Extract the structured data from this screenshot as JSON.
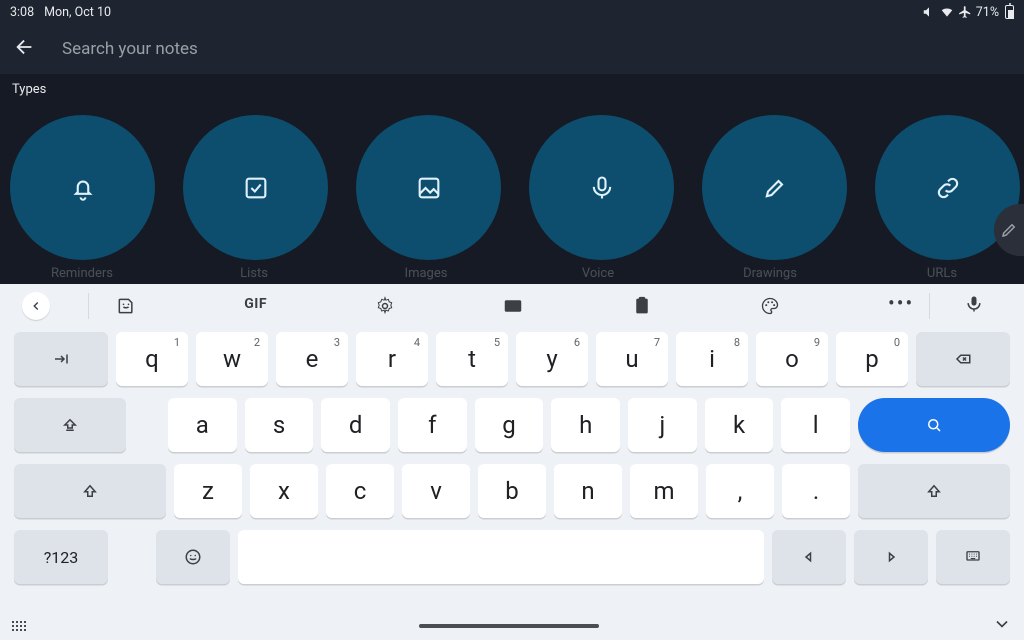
{
  "status": {
    "time": "3:08",
    "date": "Mon, Oct 10",
    "battery_pct": "71%"
  },
  "search": {
    "placeholder": "Search your notes",
    "value": ""
  },
  "types": {
    "label": "Types",
    "items": [
      {
        "name": "Reminders",
        "icon": "bell"
      },
      {
        "name": "Lists",
        "icon": "checkbox"
      },
      {
        "name": "Images",
        "icon": "image"
      },
      {
        "name": "Voice",
        "icon": "mic"
      },
      {
        "name": "Drawings",
        "icon": "brush"
      },
      {
        "name": "URLs",
        "icon": "link"
      }
    ]
  },
  "keyboard": {
    "toolbar": {
      "gif_label": "GIF"
    },
    "row1": [
      {
        "k": "q",
        "h": "1"
      },
      {
        "k": "w",
        "h": "2"
      },
      {
        "k": "e",
        "h": "3"
      },
      {
        "k": "r",
        "h": "4"
      },
      {
        "k": "t",
        "h": "5"
      },
      {
        "k": "y",
        "h": "6"
      },
      {
        "k": "u",
        "h": "7"
      },
      {
        "k": "i",
        "h": "8"
      },
      {
        "k": "o",
        "h": "9"
      },
      {
        "k": "p",
        "h": "0"
      }
    ],
    "row2": [
      "a",
      "s",
      "d",
      "f",
      "g",
      "h",
      "j",
      "k",
      "l"
    ],
    "row3": [
      "z",
      "x",
      "c",
      "v",
      "b",
      "n",
      "m",
      ",",
      "."
    ],
    "symbols_label": "?123"
  }
}
